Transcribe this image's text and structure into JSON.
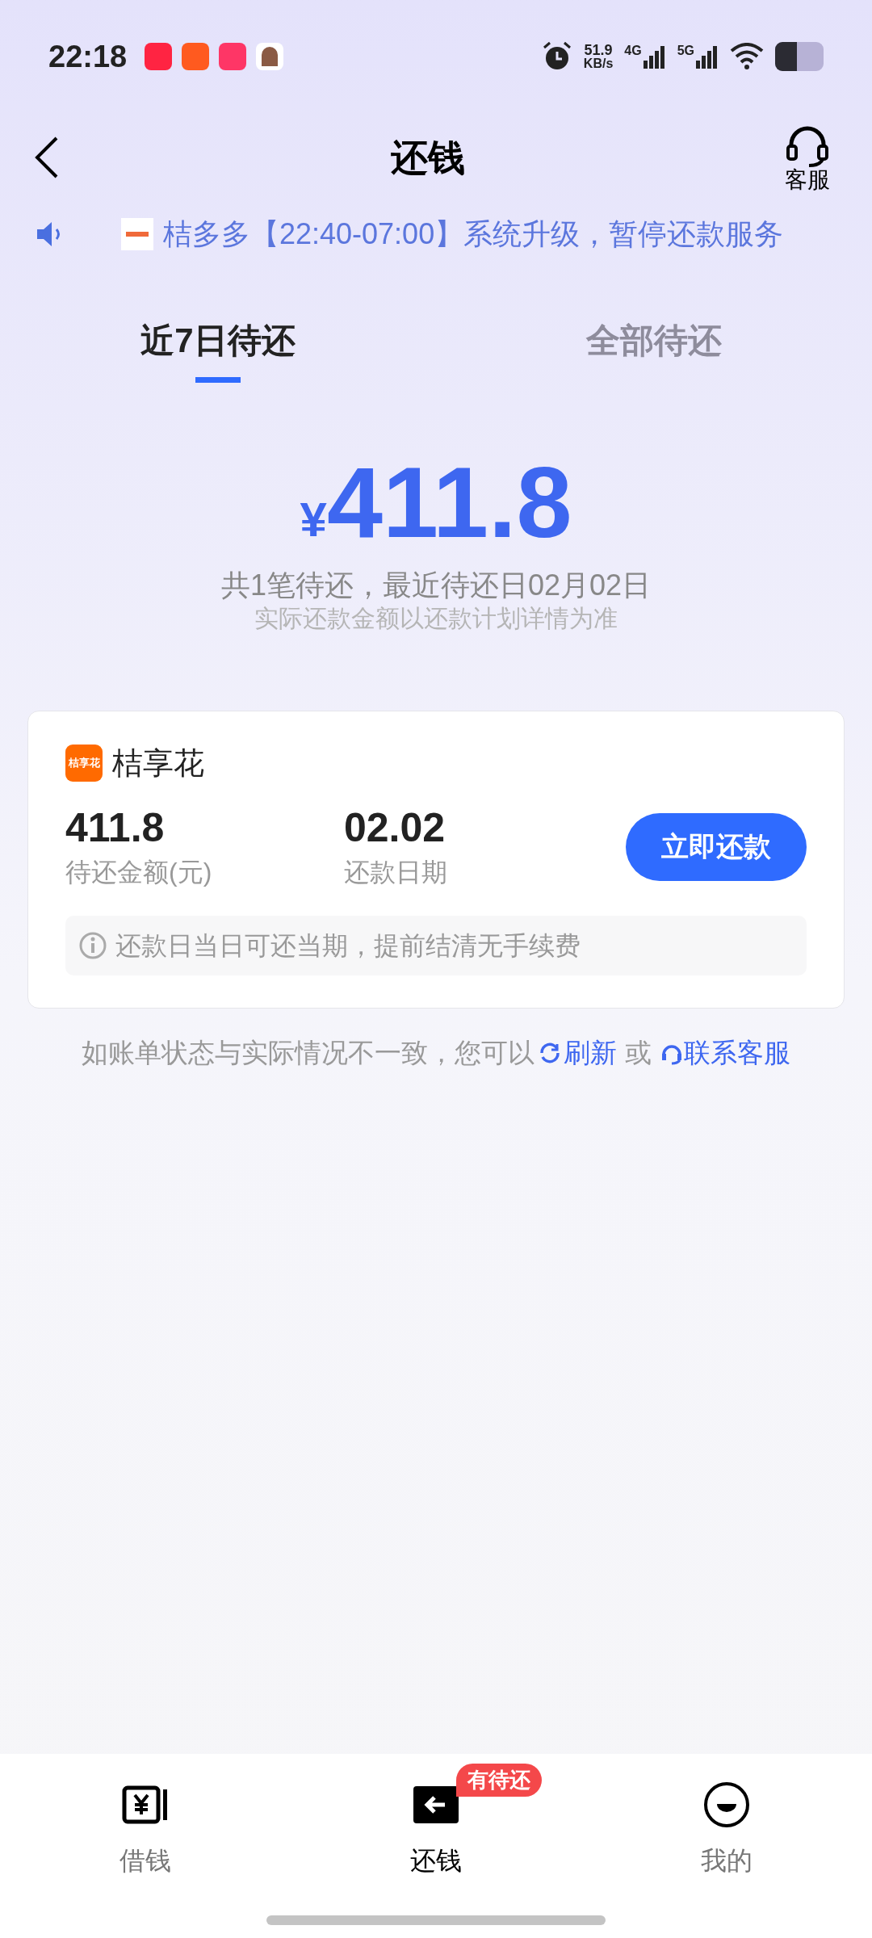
{
  "status_bar": {
    "time": "22:18",
    "speed": "51.9",
    "speed_unit": "KB/s",
    "networks": [
      "4G",
      "5G"
    ]
  },
  "header": {
    "title": "还钱",
    "service_label": "客服"
  },
  "notice": {
    "text": "桔多多【22:40-07:00】系统升级，暂停还款服务"
  },
  "tabs": [
    {
      "label": "近7日待还",
      "selected": true
    },
    {
      "label": "全部待还",
      "selected": false
    }
  ],
  "summary": {
    "currency": "¥",
    "amount": "411.8",
    "line1": "共1笔待还，最近待还日02月02日",
    "line2": "实际还款金额以还款计划详情为准"
  },
  "card": {
    "logo_text": "桔享花",
    "name": "桔享花",
    "amount": "411.8",
    "amount_label": "待还金额(元)",
    "date": "02.02",
    "date_label": "还款日期",
    "button": "立即还款",
    "tip": "还款日当日可还当期，提前结清无手续费"
  },
  "footer_note": {
    "text": "如账单状态与实际情况不一致，您可以",
    "refresh": "刷新",
    "or": "或",
    "contact": "联系客服"
  },
  "bottom_nav": [
    {
      "label": "借钱",
      "kind": "borrow",
      "selected": false
    },
    {
      "label": "还钱",
      "kind": "repay",
      "selected": true,
      "badge": "有待还"
    },
    {
      "label": "我的",
      "kind": "me",
      "selected": false
    }
  ]
}
